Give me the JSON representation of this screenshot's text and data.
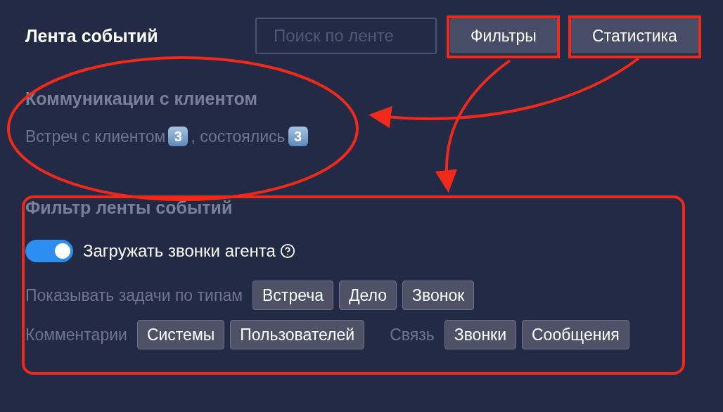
{
  "header": {
    "title": "Лента событий",
    "search": {
      "placeholder": "Поиск по ленте"
    },
    "buttons": [
      "Фильтры",
      "Статистика"
    ]
  },
  "communications": {
    "title": "Коммуникации с клиентом",
    "stats": [
      {
        "label": "Встреч с клиентом",
        "count": "3"
      },
      {
        "label": ", состоялись",
        "count": "3"
      }
    ]
  },
  "filter": {
    "title": "Фильтр ленты событий",
    "toggle": {
      "label": "Загружать звонки агента",
      "on": true
    },
    "rows": [
      [
        {
          "label": "Показывать задачи по типам",
          "chips": [
            "Встреча",
            "Дело",
            "Звонок"
          ]
        }
      ],
      [
        {
          "label": "Комментарии",
          "chips": [
            "Системы",
            "Пользователей"
          ]
        },
        {
          "label": "Связь",
          "chips": [
            "Звонки",
            "Сообщения"
          ]
        }
      ]
    ]
  }
}
